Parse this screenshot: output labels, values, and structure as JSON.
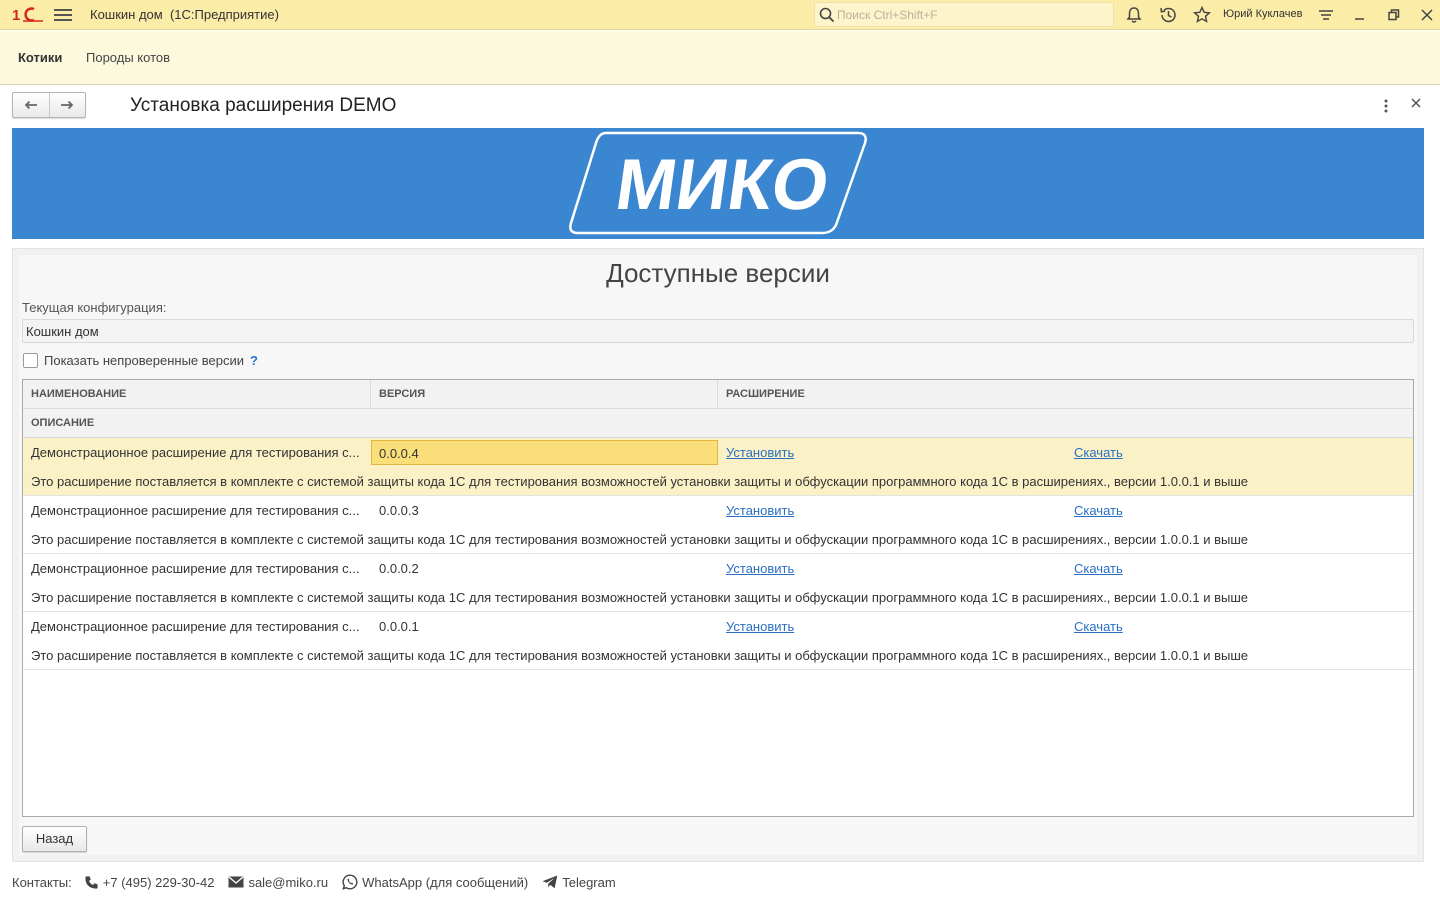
{
  "titlebar": {
    "logo": "1С",
    "title": "Кошкин дом  (1С:Предприятие)",
    "search_placeholder": "Поиск Ctrl+Shift+F",
    "user": "Юрий Куклачев"
  },
  "sections": [
    {
      "label": "Котики",
      "active": true
    },
    {
      "label": "Породы котов",
      "active": false
    }
  ],
  "form": {
    "title": "Установка расширения DEMO",
    "banner_logo": "МИКО",
    "heading": "Доступные версии",
    "config_label": "Текущая конфигурация:",
    "config_value": "Кошкин дом",
    "checkbox_label": "Показать непроверенные версии",
    "help": "?"
  },
  "table": {
    "columns": [
      "НАИМЕНОВАНИЕ",
      "ВЕРСИЯ",
      "РАСШИРЕНИЕ"
    ],
    "subheader": "ОПИСАНИЕ",
    "rows": [
      {
        "name": "Демонстрационное расширение для тестирования с...",
        "version": "0.0.0.4",
        "install": "Установить",
        "download": "Скачать",
        "description": "Это расширение поставляется в комплекте с системой защиты кода 1С для тестирования возможностей установки защиты и обфускации программного кода 1С в расширениях., версии 1.0.0.1 и выше"
      },
      {
        "name": "Демонстрационное расширение для тестирования с...",
        "version": "0.0.0.3",
        "install": "Установить",
        "download": "Скачать",
        "description": "Это расширение поставляется в комплекте с системой защиты кода 1С для тестирования возможностей установки защиты и обфускации программного кода 1С в расширениях., версии 1.0.0.1 и выше"
      },
      {
        "name": "Демонстрационное расширение для тестирования с...",
        "version": "0.0.0.2",
        "install": "Установить",
        "download": "Скачать",
        "description": "Это расширение поставляется в комплекте с системой защиты кода 1С для тестирования возможностей установки защиты и обфускации программного кода 1С в расширениях., версии 1.0.0.1 и выше"
      },
      {
        "name": "Демонстрационное расширение для тестирования с...",
        "version": "0.0.0.1",
        "install": "Установить",
        "download": "Скачать",
        "description": "Это расширение поставляется в комплекте с системой защиты кода 1С для тестирования возможностей установки защиты и обфускации программного кода 1С в расширениях., версии 1.0.0.1 и выше"
      }
    ]
  },
  "buttons": {
    "back": "Назад"
  },
  "contacts": {
    "label": "Контакты:",
    "phone": "+7 (495) 229-30-42",
    "email": "sale@miko.ru",
    "whatsapp": "WhatsApp (для сообщений)",
    "telegram": "Telegram"
  },
  "colors": {
    "titlebar_bg": "#fbeca8",
    "sections_bg": "#fcf9dd",
    "banner_bg": "#3a86d0",
    "selected_row": "#fbf1c7",
    "link": "#2a6fc4"
  }
}
